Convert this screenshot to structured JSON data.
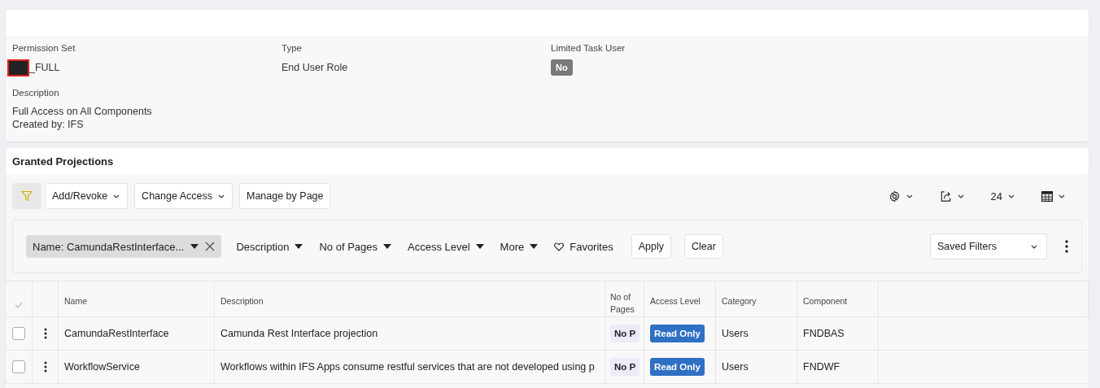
{
  "details": {
    "permission_set": {
      "label": "Permission Set",
      "redacted": true,
      "value": "_FULL"
    },
    "type": {
      "label": "Type",
      "value": "End User Role"
    },
    "limited_task_user": {
      "label": "Limited Task User",
      "value": "No"
    },
    "description": {
      "label": "Description",
      "lines": [
        "Full Access on All Components",
        "Created by: IFS"
      ]
    }
  },
  "projections": {
    "title": "Granted Projections",
    "toolbar": {
      "buttons": [
        {
          "label": "Add/Revoke",
          "dropdown": true
        },
        {
          "label": "Change Access",
          "dropdown": true
        },
        {
          "label": "Manage by Page",
          "dropdown": false
        }
      ],
      "page_size": "24"
    },
    "filters": {
      "chip": "Name: CamundaRestInterface...",
      "dropdowns": [
        "Description",
        "No of Pages",
        "Access Level",
        "More"
      ],
      "favorites": "Favorites",
      "apply": "Apply",
      "clear": "Clear",
      "saved_filters": "Saved Filters"
    },
    "table": {
      "columns": [
        "Name",
        "Description",
        "No of Pages",
        "Access Level",
        "Category",
        "Component"
      ],
      "rows": [
        {
          "checked": false,
          "name": "CamundaRestInterface",
          "description": "Camunda Rest Interface projection",
          "pages": "No P",
          "access": "Read Only",
          "category": "Users",
          "component": "FNDBAS"
        },
        {
          "checked": false,
          "name": "WorkflowService",
          "description": "Workflows within IFS Apps consume restful services that are not developed using p",
          "pages": "No P",
          "access": "Read Only",
          "category": "Users",
          "component": "FNDWF"
        }
      ]
    }
  }
}
